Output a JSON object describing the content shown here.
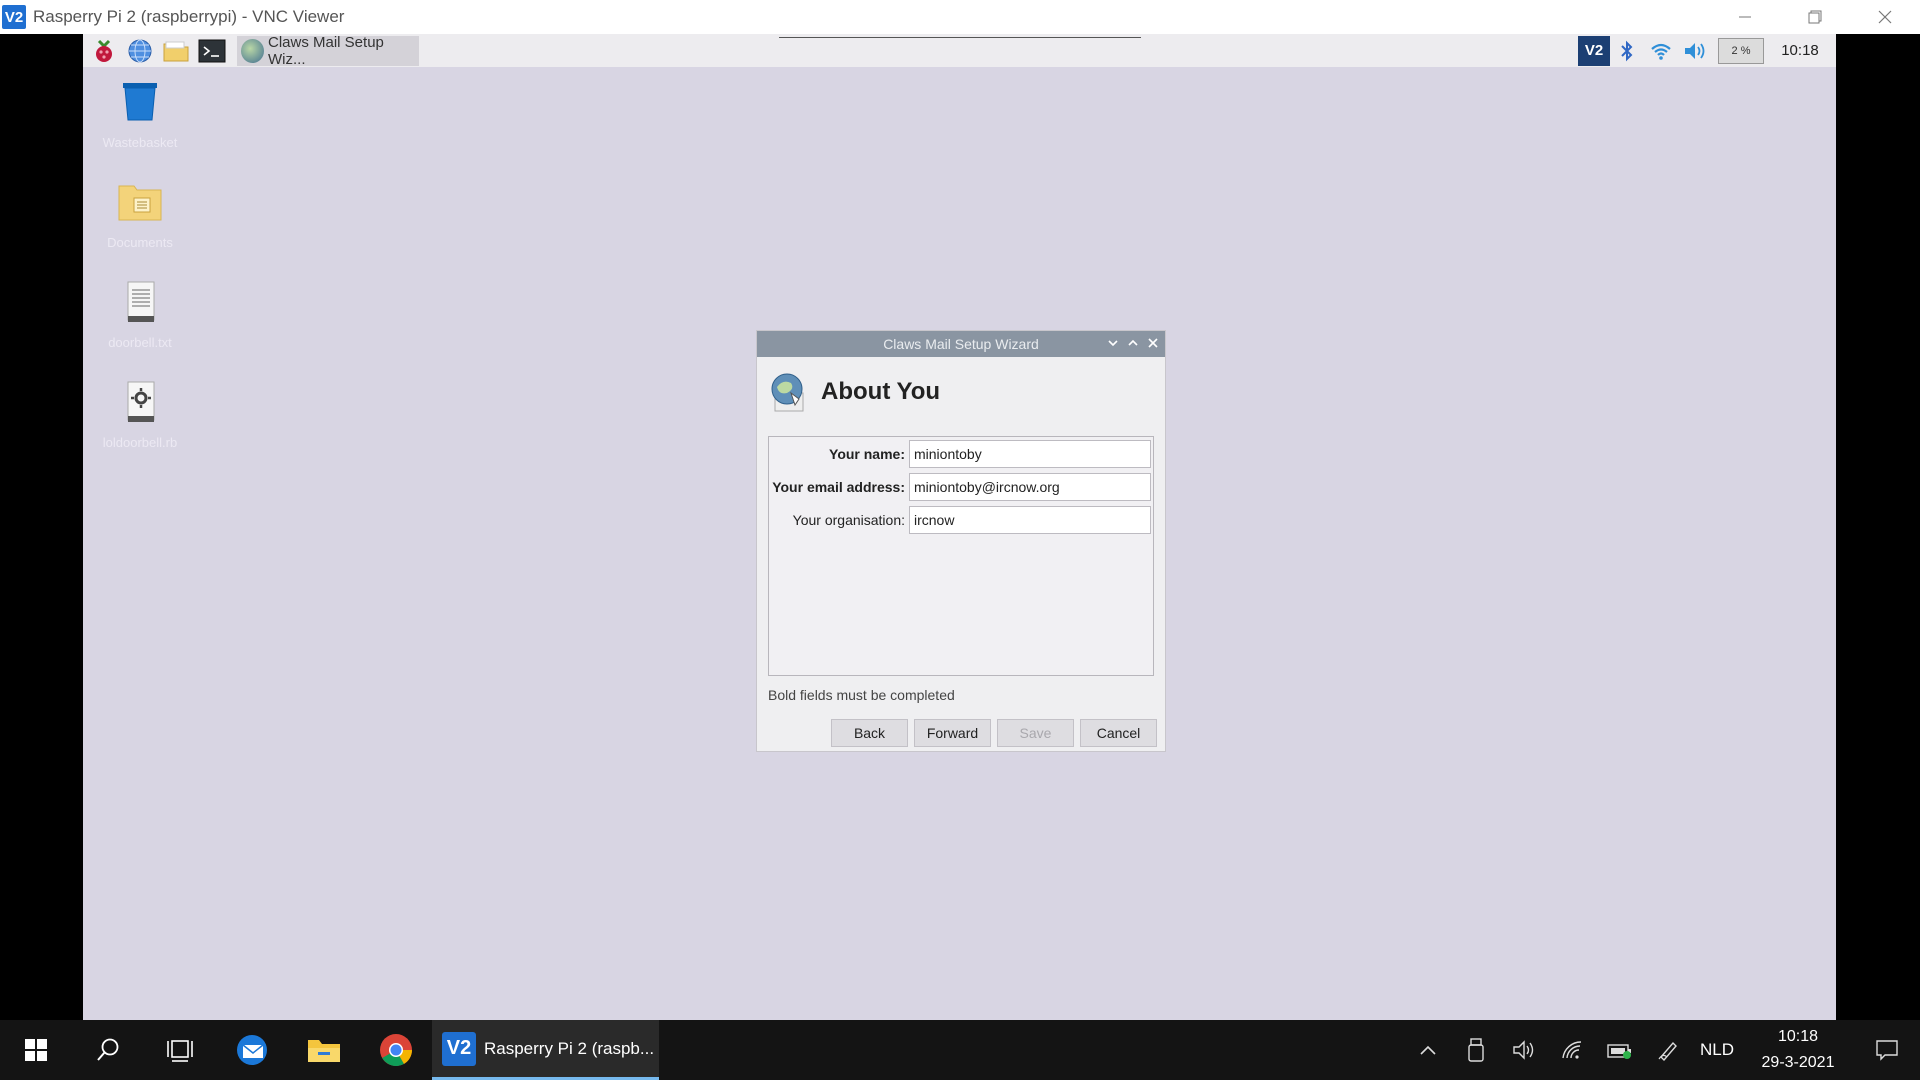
{
  "vnc_window": {
    "title": "Rasperry Pi 2 (raspberrypi) - VNC Viewer",
    "logo": "V2",
    "controls": [
      "minimize-icon",
      "restore-icon",
      "close-icon"
    ]
  },
  "rpi_panel": {
    "launchers": [
      "raspberry-menu-icon",
      "web-browser-icon",
      "file-manager-icon",
      "terminal-icon"
    ],
    "task_label": "Claws Mail Setup Wiz...",
    "tray": {
      "vnc_label": "V2",
      "cpu": "2 %",
      "clock": "10:18"
    }
  },
  "desktop_icons": [
    {
      "label": "Wastebasket",
      "icon": "wastebasket-icon"
    },
    {
      "label": "Documents",
      "icon": "folder-icon"
    },
    {
      "label": "doorbell.txt",
      "icon": "text-file-icon"
    },
    {
      "label": "loldoorbell.rb",
      "icon": "script-file-icon"
    }
  ],
  "dialog": {
    "title": "Claws Mail Setup Wizard",
    "heading": "About You",
    "fields": [
      {
        "label": "Your name:",
        "value": "miniontoby",
        "bold": true
      },
      {
        "label": "Your email address:",
        "value": "miniontoby@ircnow.org",
        "bold": true
      },
      {
        "label": "Your organisation:",
        "value": "ircnow",
        "bold": false
      }
    ],
    "note": "Bold fields must be completed",
    "buttons": {
      "back": "Back",
      "forward": "Forward",
      "save": "Save",
      "cancel": "Cancel"
    },
    "accent": "#8a95a2"
  },
  "win_taskbar": {
    "vnc_task_label": "Rasperry Pi 2 (raspb...",
    "vnc_logo": "V2",
    "language": "NLD",
    "time": "10:18",
    "date": "29-3-2021"
  }
}
